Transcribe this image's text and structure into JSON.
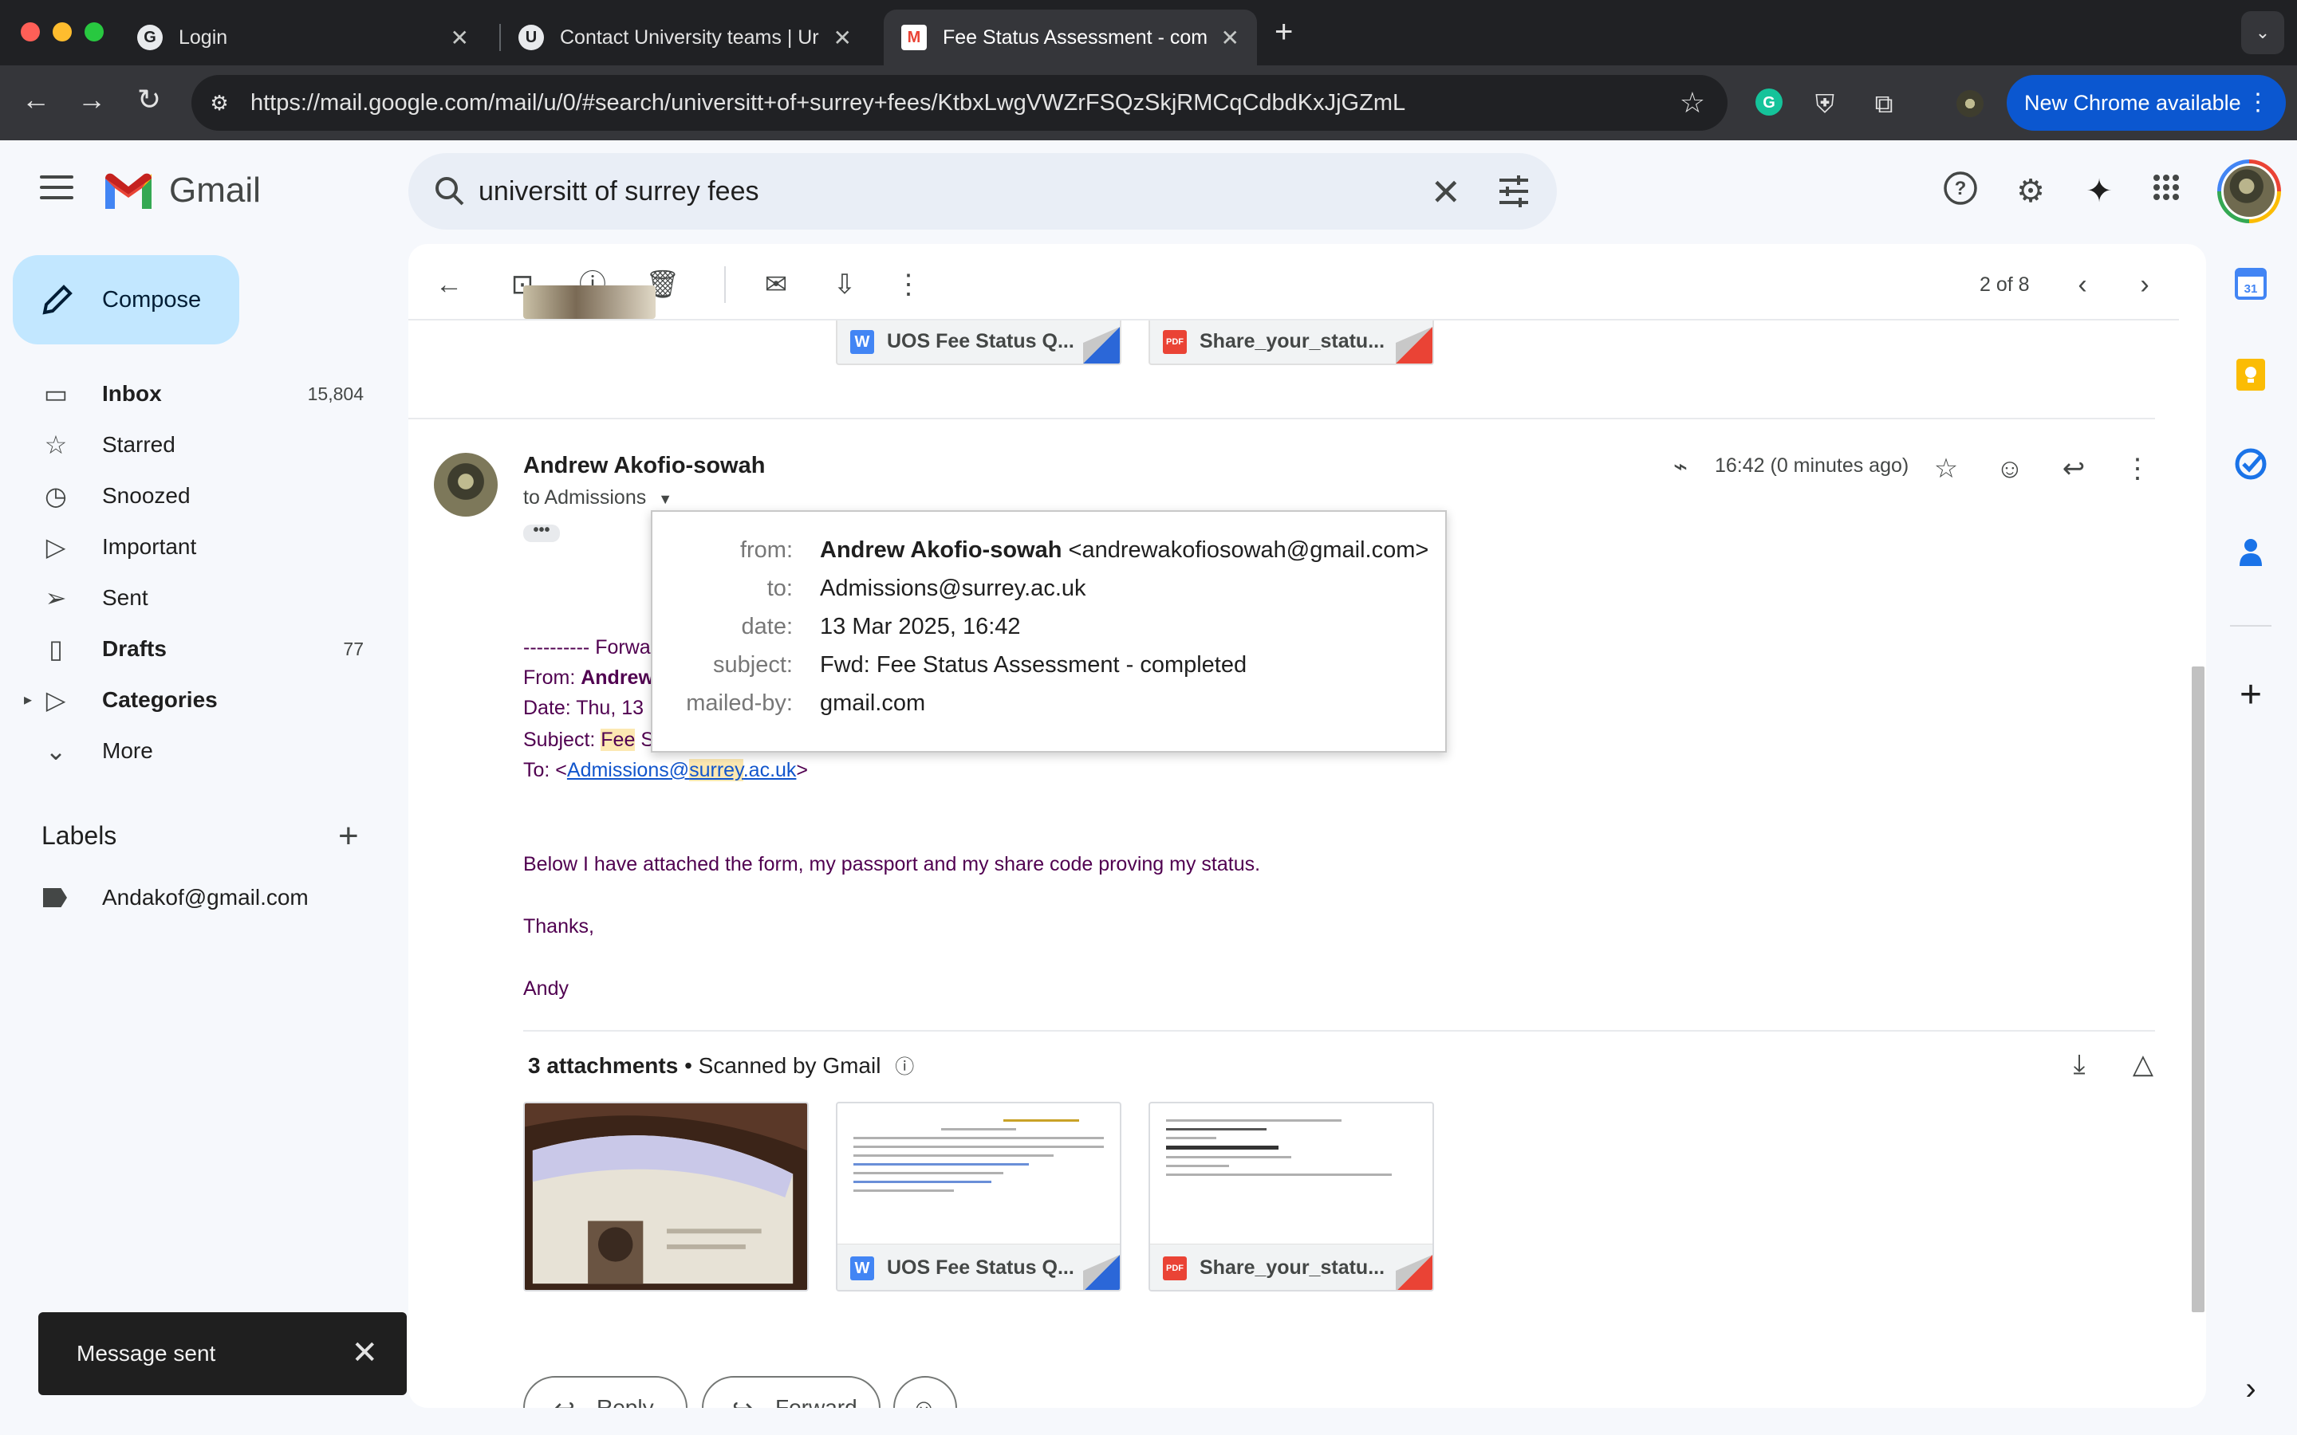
{
  "browser": {
    "tabs": [
      {
        "title": "Login",
        "favicon": "G"
      },
      {
        "title": "Contact University teams | Ur",
        "favicon": "U"
      },
      {
        "title": "Fee Status Assessment - com",
        "favicon": "M",
        "active": true
      }
    ],
    "url": "https://mail.google.com/mail/u/0/#search/universitt+of+surrey+fees/KtbxLwgVWZrFSQzSkjRMCqCdbdKxJjGZmL",
    "update_button": "New Chrome available",
    "accent": "#0b57d0"
  },
  "gmail": {
    "app_name": "Gmail",
    "search_query": "universitt of surrey fees",
    "compose_label": "Compose",
    "nav": [
      {
        "label": "Inbox",
        "count": "15,804",
        "icon": "inbox-icon",
        "bold": true
      },
      {
        "label": "Starred",
        "count": "",
        "icon": "star-icon"
      },
      {
        "label": "Snoozed",
        "count": "",
        "icon": "clock-icon"
      },
      {
        "label": "Important",
        "count": "",
        "icon": "important-icon"
      },
      {
        "label": "Sent",
        "count": "",
        "icon": "send-icon"
      },
      {
        "label": "Drafts",
        "count": "77",
        "icon": "file-icon",
        "bold": true
      },
      {
        "label": "Categories",
        "count": "",
        "icon": "label-icon",
        "bold": true
      },
      {
        "label": "More",
        "count": "",
        "icon": "chevron-down-icon"
      }
    ],
    "labels_heading": "Labels",
    "labels": [
      {
        "name": "Andakof@gmail.com"
      }
    ],
    "snackbar": "Message sent"
  },
  "thread": {
    "paging": "2 of 8",
    "prev_attachments": [
      "UOS Fee Status Q...",
      "Share_your_statu..."
    ],
    "message": {
      "sender": "Andrew Akofio-sowah",
      "to_line": "to Admissions",
      "time": "16:42 (0 minutes ago)",
      "forward_header": "---------- Forwa",
      "from_label": "From: ",
      "from_value": "Andrew",
      "date_line": "Date: Thu, 13",
      "subject_label": "Subject: ",
      "subject_value": "Fee",
      "subject_tail": " S",
      "to_label": "To: <",
      "to_email_1": "Admissions@",
      "to_email_2": "surrey",
      "to_email_3": ".ac.uk",
      "to_close": ">",
      "body": [
        "Below I have attached the form, my passport and my share code proving my status.",
        "Thanks,",
        "Andy"
      ]
    },
    "attachments": {
      "count_label": "3 attachments",
      "scanned_label": " • Scanned by Gmail",
      "files": [
        "UOS Fee Status Q...",
        "Share_your_statu..."
      ]
    },
    "reply_label": "Reply",
    "forward_label": "Forward"
  },
  "details_popup": {
    "from_key": "from:",
    "from_name": "Andrew Akofio-sowah",
    "from_email": " <andrewakofiosowah@gmail.com>",
    "to_key": "to:",
    "to_value": "Admissions@surrey.ac.uk",
    "date_key": "date:",
    "date_value": "13 Mar 2025, 16:42",
    "subject_key": "subject:",
    "subject_value": "Fwd: Fee Status Assessment - completed",
    "mailedby_key": "mailed-by:",
    "mailedby_value": "gmail.com"
  }
}
